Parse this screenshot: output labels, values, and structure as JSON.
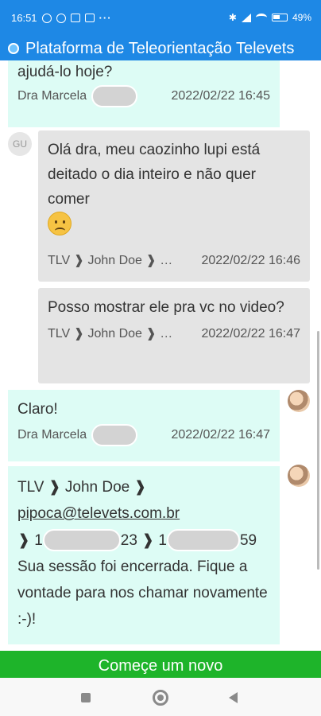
{
  "status_bar": {
    "time": "16:51",
    "battery": "49"
  },
  "app": {
    "title": "Plataforma de Teleorientação Televets"
  },
  "messages": [
    {
      "side": "left",
      "text": "ajudá-lo hoje?",
      "author": "Dra Marcela",
      "time": "2022/02/22 16:45"
    },
    {
      "side": "right",
      "avatar": "GU",
      "text": "Olá dra, meu caozinho lupi está deitado o dia inteiro e não quer comer",
      "author": "TLV ❱ John Doe ❱ …",
      "time": "2022/02/22 16:46"
    },
    {
      "side": "right",
      "text": "Posso mostrar ele pra vc no video?",
      "author": "TLV ❱ John Doe ❱ …",
      "time": "2022/02/22 16:47"
    },
    {
      "side": "left",
      "text": "Claro!",
      "author": "Dra Marcela",
      "time": "2022/02/22 16:47"
    },
    {
      "side": "left",
      "line1": "TLV ❱ John Doe ❱",
      "email": "pipoca@televets.com.br",
      "phone_a_start": "❱ 1",
      "phone_a_end": "23",
      "phone_b_start": "❱ 1",
      "phone_b_end": "59",
      "text": "Sua sessão foi encerrada. Fique a vontade para nos chamar novamente :-)!"
    }
  ],
  "cta": {
    "label": "Começe um novo"
  },
  "icons": {
    "sad_face": "slightly-frowning-face-icon",
    "bullet": "right-chevron-icon"
  },
  "colors": {
    "header": "#1e88e5",
    "incoming": "#ddfcf5",
    "outgoing": "#e4e4e4",
    "cta": "#1eb42a"
  }
}
